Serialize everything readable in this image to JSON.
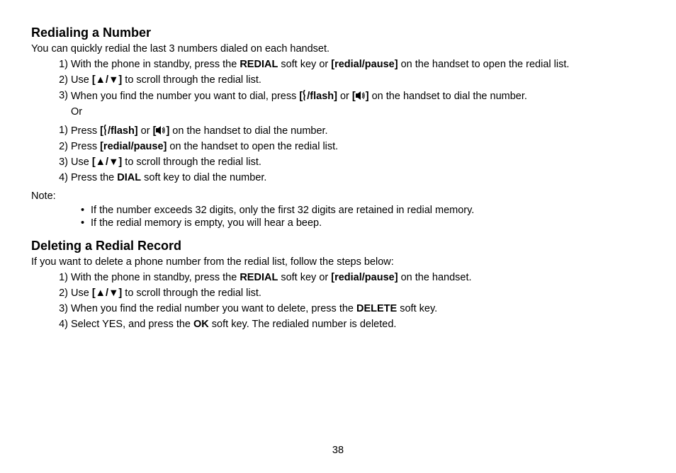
{
  "page_number": "38",
  "glyphs": {
    "arrow_up": "▲",
    "arrow_down": "▼"
  },
  "section1": {
    "heading": "Redialing a Number",
    "intro": "You can quickly redial the last 3 numbers dialed on each handset.",
    "stepsA": [
      {
        "n": "1)",
        "pre": "With the phone in standby, press the ",
        "b1": "REDIAL",
        "mid1": " soft key or ",
        "b2": "[redial/pause]",
        "post": " on the handset to open the redial list."
      },
      {
        "n": "2)",
        "pre": "Use ",
        "b1": "[",
        "updown": true,
        "b2": "]",
        "post": " to scroll through the redial list."
      },
      {
        "n": "3)",
        "pre": "When you find the number you want to dial, press ",
        "b1": "[",
        "flash": true,
        "b2": "/flash]",
        "mid1": " or ",
        "b3": "[",
        "speaker": true,
        "b4": "]",
        "post": " on the handset to dial the number."
      }
    ],
    "or": "Or",
    "stepsB": [
      {
        "n": "1)",
        "pre": "Press ",
        "b1": "[",
        "flash": true,
        "b2": "/flash]",
        "mid1": " or ",
        "b3": "[",
        "speaker": true,
        "b4": "]",
        "post": " on the handset to dial the number."
      },
      {
        "n": "2)",
        "pre": "Press ",
        "b1": "[redial/pause]",
        "post": " on the handset to open the redial list."
      },
      {
        "n": "3)",
        "pre": "Use ",
        "b1": "[",
        "updown": true,
        "b2": "]",
        "post": " to scroll through the redial list."
      },
      {
        "n": "4)",
        "pre": "Press the ",
        "b1": "DIAL",
        "post": " soft key to dial the number."
      }
    ],
    "note_label": "Note:",
    "notes": [
      "If the number exceeds 32 digits, only the first 32 digits are retained in redial memory.",
      "If the redial memory is empty, you will hear a beep."
    ]
  },
  "section2": {
    "heading": "Deleting a Redial Record",
    "intro": "If you want to delete a phone number from the redial list, follow the steps below:",
    "steps": [
      {
        "n": "1)",
        "pre": "With the phone in standby, press the ",
        "b1": "REDIAL",
        "mid1": " soft key or ",
        "b2": "[redial/pause]",
        "post": " on the handset."
      },
      {
        "n": "2)",
        "pre": "Use ",
        "b1": "[",
        "updown": true,
        "b2": "]",
        "post": " to scroll through the redial list."
      },
      {
        "n": "3)",
        "pre": "When you find the redial number you want to delete, press the ",
        "b1": "DELETE",
        "post": " soft key."
      },
      {
        "n": "4)",
        "pre": "Select YES, and press the ",
        "b1": "OK",
        "post": " soft key. The redialed number is deleted."
      }
    ]
  }
}
